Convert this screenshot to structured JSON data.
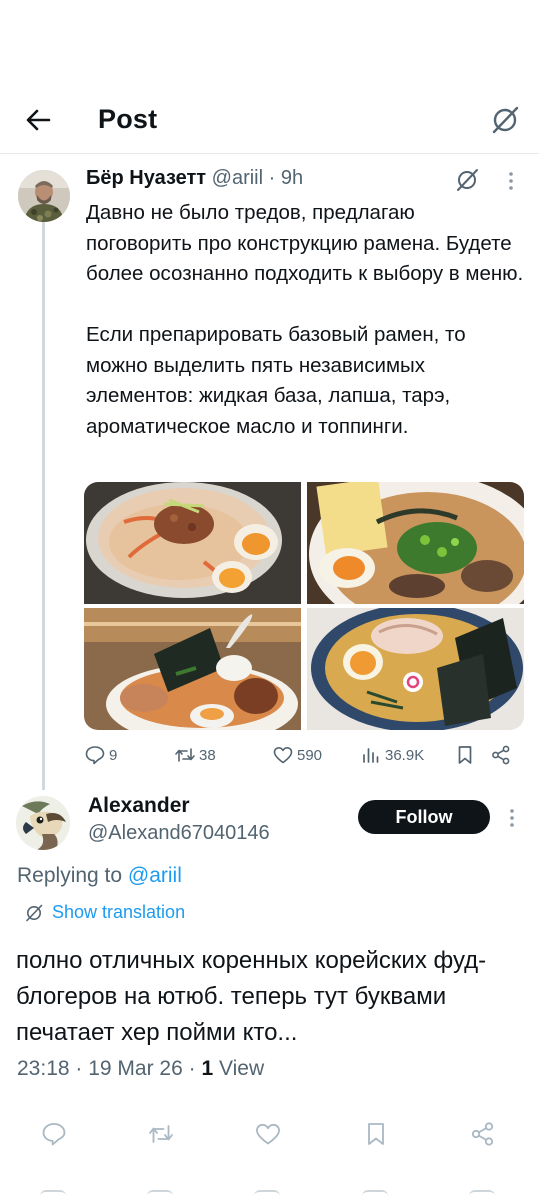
{
  "header": {
    "title": "Post",
    "back_icon": "arrow-left-icon",
    "grok_icon": "grok-icon"
  },
  "tweet": {
    "author_name": "Бёр Нуазетт",
    "author_handle": "@ariil",
    "time": "9h",
    "text": "Давно не было тредов, предлагаю поговорить про конструкцию рамена. Будете более осознанно подходить к выбору в меню.\n\nЕсли препарировать базовый рамен, то можно выделить пять независимых элементов: жидкая база, лапша, тарэ, ароматическое масло и топпинги.",
    "media": [
      {
        "name": "ramen-photo-1",
        "description_icon": "photo"
      },
      {
        "name": "ramen-photo-2",
        "description_icon": "photo"
      },
      {
        "name": "ramen-photo-3",
        "description_icon": "photo"
      },
      {
        "name": "ramen-photo-4",
        "description_icon": "photo"
      }
    ],
    "stats": {
      "replies": "9",
      "reposts": "38",
      "likes": "590",
      "views": "36.9K"
    }
  },
  "reply": {
    "author_name": "Alexander",
    "author_handle": "@Alexand67040146",
    "follow_label": "Follow",
    "replying_prefix": "Replying to",
    "replying_to": "@ariil",
    "show_translation": "Show translation",
    "text": "полно отличных коренных корейских фуд-блогеров на ютюб. теперь тут буквами печатает хер пойми кто...",
    "time": "23:18",
    "date": "19 Mar 26",
    "views_count": "1",
    "views_label": "View"
  },
  "colors": {
    "accent": "#1d9bf0",
    "text": "#0f1419",
    "secondary": "#536471",
    "divider": "#e6e9eb"
  }
}
